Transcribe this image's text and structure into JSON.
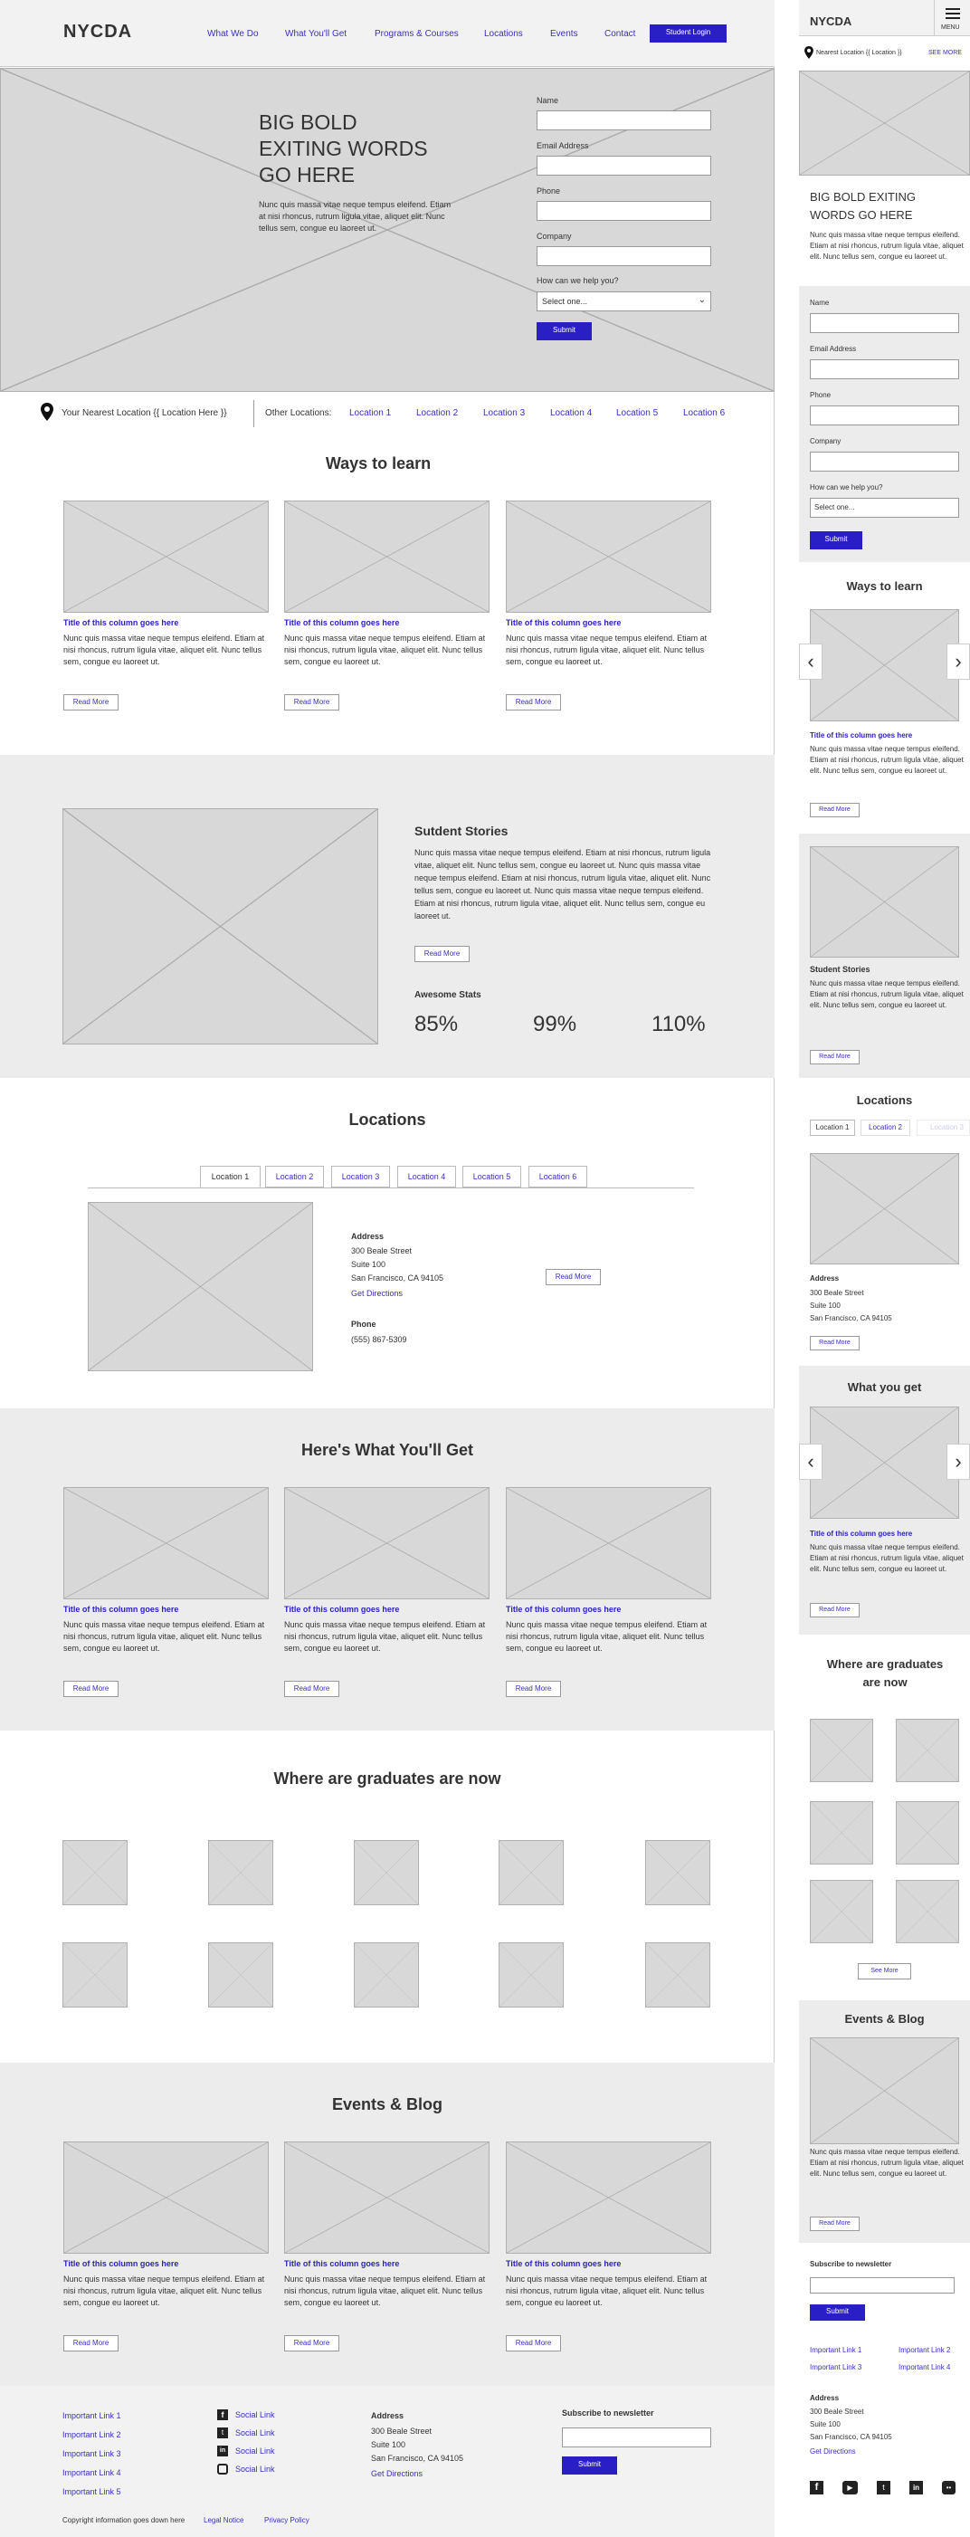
{
  "brand": "NYCDA",
  "nav": {
    "items": [
      "What We Do",
      "What You'll Get",
      "Programs & Courses",
      "Locations",
      "Events",
      "Contact"
    ],
    "login": "Student Login"
  },
  "hero": {
    "title": "BIG BOLD\nEXITING WORDS\nGO HERE",
    "body": "Nunc quis massa vitae neque tempus eleifend. Etiam at nisi rhoncus, rutrum ligula vitae, aliquet elit. Nunc tellus sem, congue eu laoreet ut."
  },
  "form": {
    "labels": [
      "Name",
      "Email Address",
      "Phone",
      "Company",
      "How can we help you?"
    ],
    "select_value": "Select one...",
    "submit": "Submit"
  },
  "locbar": {
    "nearest": "Your Nearest Location {{ Location Here }}",
    "other": "Other Locations:",
    "locations": [
      "Location 1",
      "Location 2",
      "Location 3",
      "Location 4",
      "Location 5",
      "Location 6"
    ]
  },
  "ways": {
    "title": "Ways to learn",
    "col_title": "Title of this column goes here",
    "col_body": "Nunc quis massa vitae neque tempus eleifend. Etiam at nisi rhoncus, rutrum ligula vitae, aliquet elit. Nunc tellus sem, congue eu laoreet ut.",
    "read_more": "Read More"
  },
  "stories": {
    "title": "Sutdent Stories",
    "body": "Nunc quis massa vitae neque tempus eleifend. Etiam at nisi rhoncus, rutrum ligula vitae, aliquet elit. Nunc tellus sem, congue eu laoreet ut. Nunc quis massa vitae neque tempus eleifend. Etiam at nisi rhoncus, rutrum ligula vitae, aliquet elit. Nunc tellus sem, congue eu laoreet ut. Nunc quis massa vitae neque tempus eleifend. Etiam at nisi rhoncus, rutrum ligula vitae, aliquet elit. Nunc tellus sem, congue eu laoreet ut.",
    "read_more": "Read More",
    "stats_title": "Awesome Stats",
    "stats": [
      "85%",
      "99%",
      "110%"
    ]
  },
  "locations": {
    "title": "Locations",
    "address_label": "Address",
    "address_lines": [
      "300 Beale Street",
      "Suite 100",
      "San Francisco, CA 94105"
    ],
    "directions": "Get Directions",
    "phone_label": "Phone",
    "phone": "(555) 867-5309",
    "read_more": "Read More"
  },
  "whatget": {
    "title": "Here's What You'll Get"
  },
  "grads": {
    "title": "Where are graduates are now"
  },
  "events": {
    "title": "Events & Blog"
  },
  "footer": {
    "links": [
      "Important Link 1",
      "Important Link 2",
      "Important Link 3",
      "Important Link 4",
      "Important Link 5"
    ],
    "social_label": "Social Link",
    "address_label": "Address",
    "directions": "Get Directions",
    "newsletter": "Subscribe to newsletter",
    "submit": "Submit",
    "copyright": "Copyright information goes down here",
    "legal": "Legal Notice",
    "privacy": "Privacy Policy"
  },
  "mobile": {
    "menu": "MENU",
    "nearest": "Nearest Location {{ Location }}",
    "see_more": "SEE MORE",
    "hero_title": "BIG BOLD EXITING WORDS GO HERE",
    "ways": "Ways to learn",
    "stories": "Student Stories",
    "locations": "Locations",
    "what": "What you get",
    "grads_title": "Where are graduates are now",
    "see_more_btn": "See More",
    "events": "Events & Blog",
    "newsletter": "Subscribe to newsletter",
    "mlinks": [
      "Important Link 1",
      "Important Link 2",
      "Important Link 3",
      "Important Link 4"
    ]
  }
}
